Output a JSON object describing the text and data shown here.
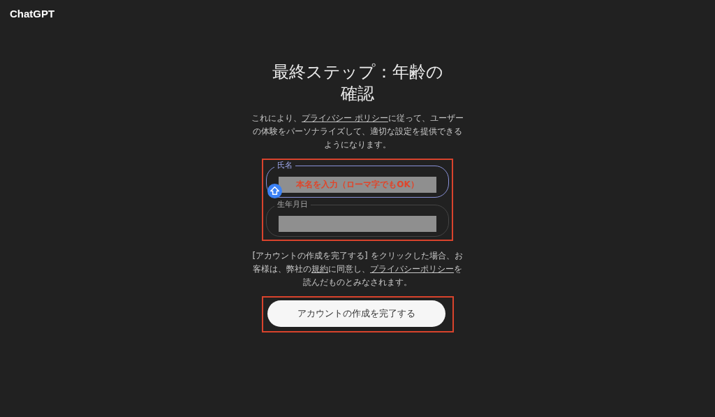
{
  "logo": "ChatGPT",
  "title": "最終ステップ：年齢の確認",
  "intro": [
    {
      "kind": "text",
      "text": "これにより、"
    },
    {
      "kind": "link",
      "text": "プライバシー ポリシー"
    },
    {
      "kind": "text",
      "text": "に従って、ユーザーの体験をパーソナライズして、適切な設定を提供できるようになります。"
    }
  ],
  "fields": [
    {
      "label": "氏名",
      "focused": true,
      "annotation": "本名を入力（ローマ字でもOK）"
    },
    {
      "label": "生年月日",
      "focused": false
    }
  ],
  "terms": [
    {
      "kind": "text",
      "text": "[アカウントの作成を完了する] をクリックした場合、お客様は、弊社の"
    },
    {
      "kind": "link",
      "text": "規約"
    },
    {
      "kind": "text",
      "text": "に同意し、"
    },
    {
      "kind": "link",
      "text": "プライバシーポリシー"
    },
    {
      "kind": "text",
      "text": "を読んだものとみなされます。"
    }
  ],
  "submit": "アカウントの作成を完了する"
}
